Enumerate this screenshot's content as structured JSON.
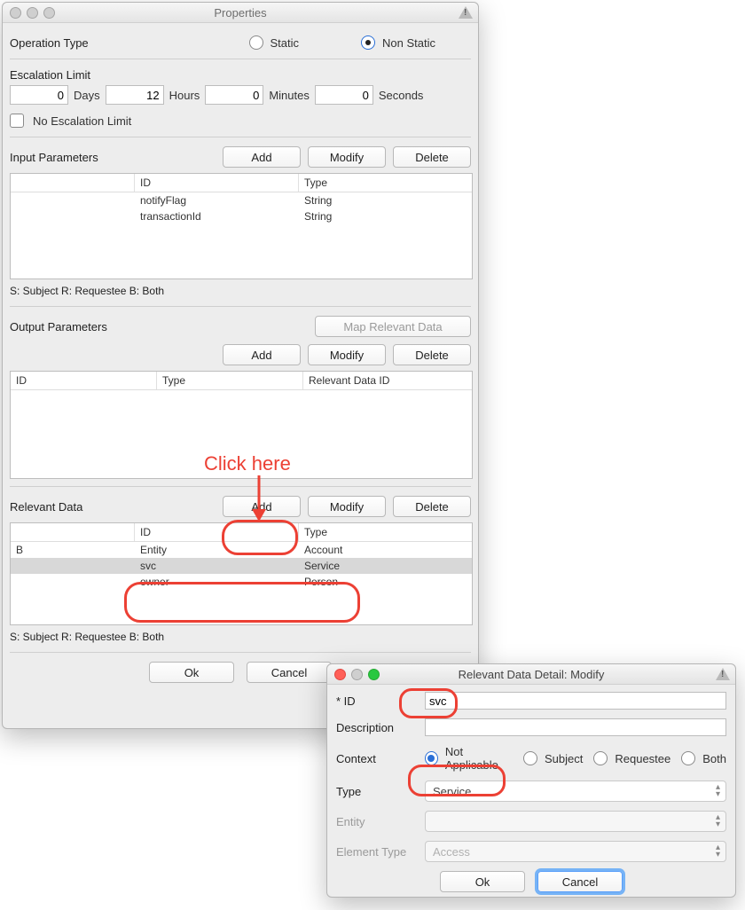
{
  "properties_window": {
    "title": "Properties",
    "operation_type": {
      "label": "Operation Type",
      "static_label": "Static",
      "nonstatic_label": "Non Static"
    },
    "escalation": {
      "label": "Escalation Limit",
      "days_value": "0",
      "days_unit": "Days",
      "hours_value": "12",
      "hours_unit": "Hours",
      "minutes_value": "0",
      "minutes_unit": "Minutes",
      "seconds_value": "0",
      "seconds_unit": "Seconds",
      "no_limit_label": "No Escalation Limit"
    },
    "buttons": {
      "add": "Add",
      "modify": "Modify",
      "delete": "Delete",
      "map_relevant": "Map Relevant Data",
      "ok": "Ok",
      "cancel": "Cancel"
    },
    "input_parameters": {
      "label": "Input Parameters",
      "cols": {
        "rel": "",
        "id": "ID",
        "type": "Type"
      },
      "rows": [
        {
          "rel": "",
          "id": "notifyFlag",
          "type": "String"
        },
        {
          "rel": "",
          "id": "transactionId",
          "type": "String"
        }
      ]
    },
    "legend": "S: Subject    R: Requestee    B: Both",
    "output_parameters": {
      "label": "Output Parameters",
      "cols": {
        "id": "ID",
        "type": "Type",
        "rd": "Relevant Data ID"
      }
    },
    "relevant_data": {
      "label": "Relevant Data",
      "cols": {
        "rel": "",
        "id": "ID",
        "type": "Type"
      },
      "rows": [
        {
          "rel": "B",
          "id": "Entity",
          "type": "Account"
        },
        {
          "rel": "",
          "id": "svc",
          "type": "Service"
        },
        {
          "rel": "",
          "id": "owner",
          "type": "Person"
        }
      ]
    }
  },
  "annotation": {
    "click_here": "Click here"
  },
  "detail_window": {
    "title": "Relevant Data Detail: Modify",
    "id_label": "* ID",
    "id_value": "svc",
    "description_label": "Description",
    "description_value": "",
    "context_label": "Context",
    "context_options": {
      "na": "Not Applicable",
      "subject": "Subject",
      "requestee": "Requestee",
      "both": "Both"
    },
    "type_label": "Type",
    "type_value": "Service",
    "entity_label": "Entity",
    "entity_value": "",
    "element_type_label": "Element Type",
    "element_type_value": "Access",
    "ok": "Ok",
    "cancel": "Cancel"
  }
}
